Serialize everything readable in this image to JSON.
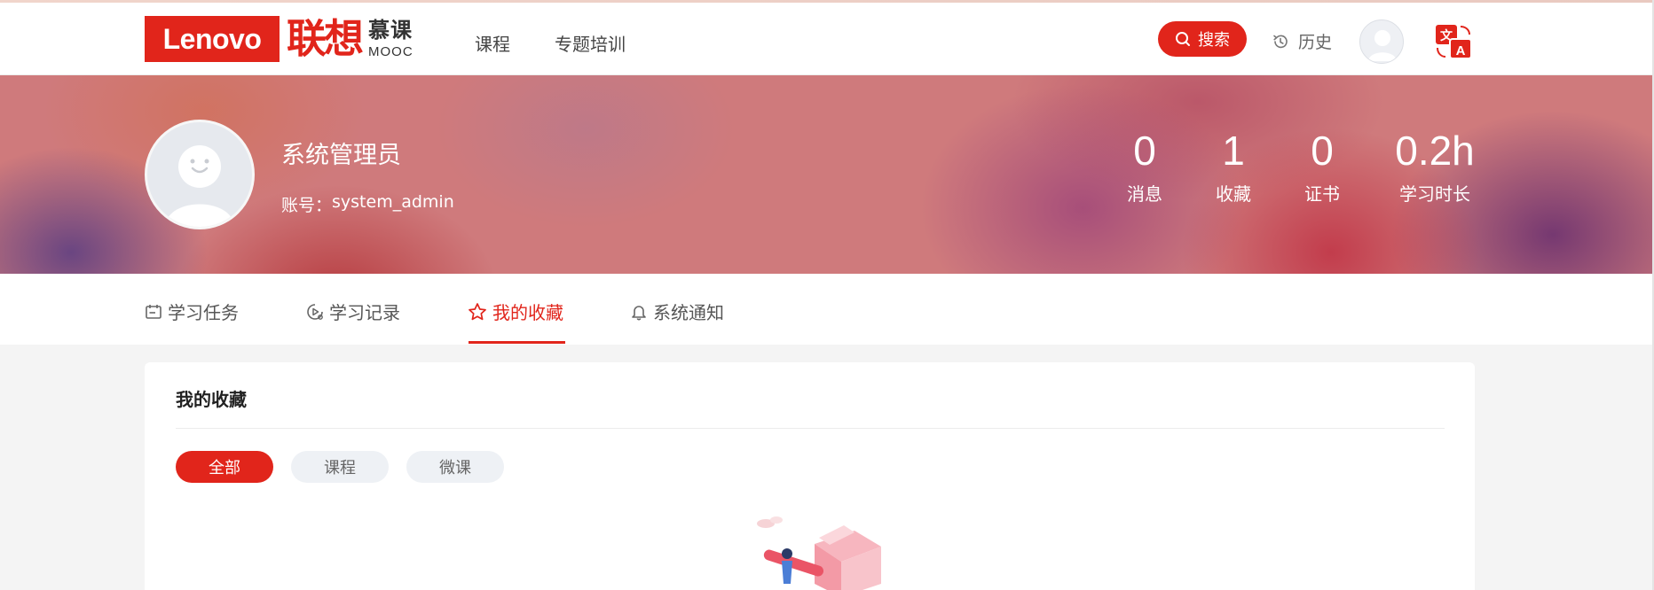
{
  "header": {
    "logo_brand": "Lenovo",
    "logo_cn": "联想",
    "logo_mooc_cn": "慕课",
    "logo_mooc_en": "MOOC",
    "nav": [
      {
        "label": "课程"
      },
      {
        "label": "专题培训"
      }
    ],
    "search_label": "搜索",
    "history_label": "历史",
    "lang_icon": "translate-icon"
  },
  "profile": {
    "name": "系统管理员",
    "account_label": "账号：",
    "account_value": "system_admin"
  },
  "stats": [
    {
      "value": "0",
      "label": "消息"
    },
    {
      "value": "1",
      "label": "收藏"
    },
    {
      "value": "0",
      "label": "证书"
    },
    {
      "value": "0.2h",
      "label": "学习时长"
    }
  ],
  "tabs": [
    {
      "label": "学习任务",
      "icon": "calendar-icon"
    },
    {
      "label": "学习记录",
      "icon": "record-icon"
    },
    {
      "label": "我的收藏",
      "icon": "star-icon",
      "active": true
    },
    {
      "label": "系统通知",
      "icon": "bell-icon"
    }
  ],
  "favorites": {
    "title": "我的收藏",
    "filters": [
      {
        "label": "全部",
        "active": true
      },
      {
        "label": "课程",
        "active": false
      },
      {
        "label": "微课",
        "active": false
      }
    ]
  },
  "colors": {
    "brand_red": "#e1251b",
    "pill_inactive": "#eef1f5"
  }
}
